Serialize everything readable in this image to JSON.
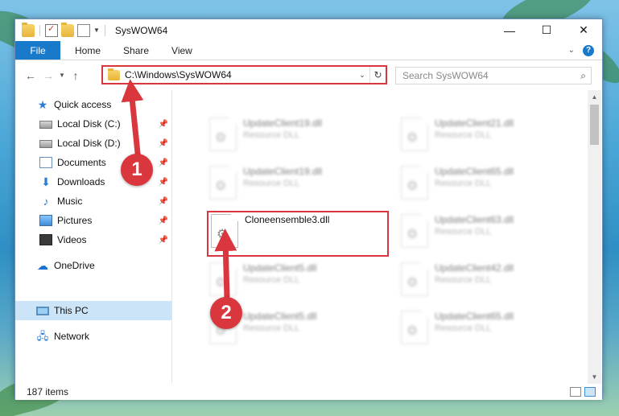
{
  "window": {
    "title": "SysWOW64",
    "controls": {
      "minimize": "—",
      "maximize": "☐",
      "close": "✕"
    }
  },
  "ribbon": {
    "tabs": [
      "File",
      "Home",
      "Share",
      "View"
    ]
  },
  "address": {
    "path": "C:\\Windows\\SysWOW64",
    "search_placeholder": "Search SysWOW64"
  },
  "navpane": {
    "items": [
      {
        "label": "Quick access",
        "icon": "star-icon"
      },
      {
        "label": "Local Disk (C:)",
        "icon": "drive-icon",
        "pinned": true
      },
      {
        "label": "Local Disk (D:)",
        "icon": "drive-icon",
        "pinned": true
      },
      {
        "label": "Documents",
        "icon": "documents-icon",
        "pinned": true
      },
      {
        "label": "Downloads",
        "icon": "download-icon",
        "pinned": true
      },
      {
        "label": "Music",
        "icon": "music-icon",
        "pinned": true
      },
      {
        "label": "Pictures",
        "icon": "pictures-icon",
        "pinned": true
      },
      {
        "label": "Videos",
        "icon": "videos-icon",
        "pinned": true
      },
      {
        "label": "OneDrive",
        "icon": "onedrive-icon"
      },
      {
        "label": "This PC",
        "icon": "computer-icon",
        "selected": true
      },
      {
        "label": "Network",
        "icon": "network-icon"
      }
    ]
  },
  "files": [
    {
      "name": "UpdateClient19.dll",
      "type": "Resource DLL",
      "blurred": true
    },
    {
      "name": "UpdateClient21.dll",
      "type": "Resource DLL",
      "blurred": true
    },
    {
      "name": "UpdateClient19.dll",
      "type": "Resource DLL",
      "blurred": true
    },
    {
      "name": "UpdateClient65.dll",
      "type": "Resource DLL",
      "blurred": true
    },
    {
      "name": "Cloneensemble3.dll",
      "type": "",
      "blurred": false
    },
    {
      "name": "UpdateClient63.dll",
      "type": "Resource DLL",
      "blurred": true
    },
    {
      "name": "UpdateClient5.dll",
      "type": "Resource DLL",
      "blurred": true
    },
    {
      "name": "UpdateClient42.dll",
      "type": "Resource DLL",
      "blurred": true
    },
    {
      "name": "UpdateClient5.dll",
      "type": "Resource DLL",
      "blurred": true
    },
    {
      "name": "UpdateClient65.dll",
      "type": "Resource DLL",
      "blurred": true
    }
  ],
  "status": {
    "item_count": "187 items"
  },
  "annotations": {
    "step1": "1",
    "step2": "2",
    "accent": "#d9363e"
  }
}
